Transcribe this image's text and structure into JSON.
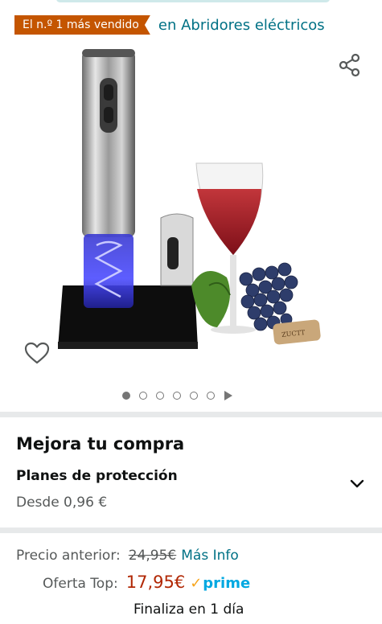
{
  "header": {
    "badge_label": "El n.º 1 más vendido",
    "category_link": "en Abridores eléctricos"
  },
  "gallery": {
    "image_count": 6,
    "active_index": 0,
    "has_video": true
  },
  "upgrade": {
    "title": "Mejora tu compra",
    "plan_title": "Planes de protección",
    "plan_price": "Desde 0,96 €"
  },
  "pricing": {
    "previous_label": "Precio anterior:",
    "previous_price": "24,95€",
    "more_info": "Más Info",
    "deal_label": "Oferta Top:",
    "deal_price": "17,95€",
    "prime_label": "prime",
    "ends_text": "Finaliza en 1 día"
  },
  "colors": {
    "badge": "#c45500",
    "link": "#007185",
    "deal_price": "#b12704",
    "prime_blue": "#00a8e1",
    "prime_check": "#f7a51c"
  },
  "icons": [
    "share-icon",
    "heart-icon",
    "chevron-down-icon",
    "play-icon"
  ]
}
